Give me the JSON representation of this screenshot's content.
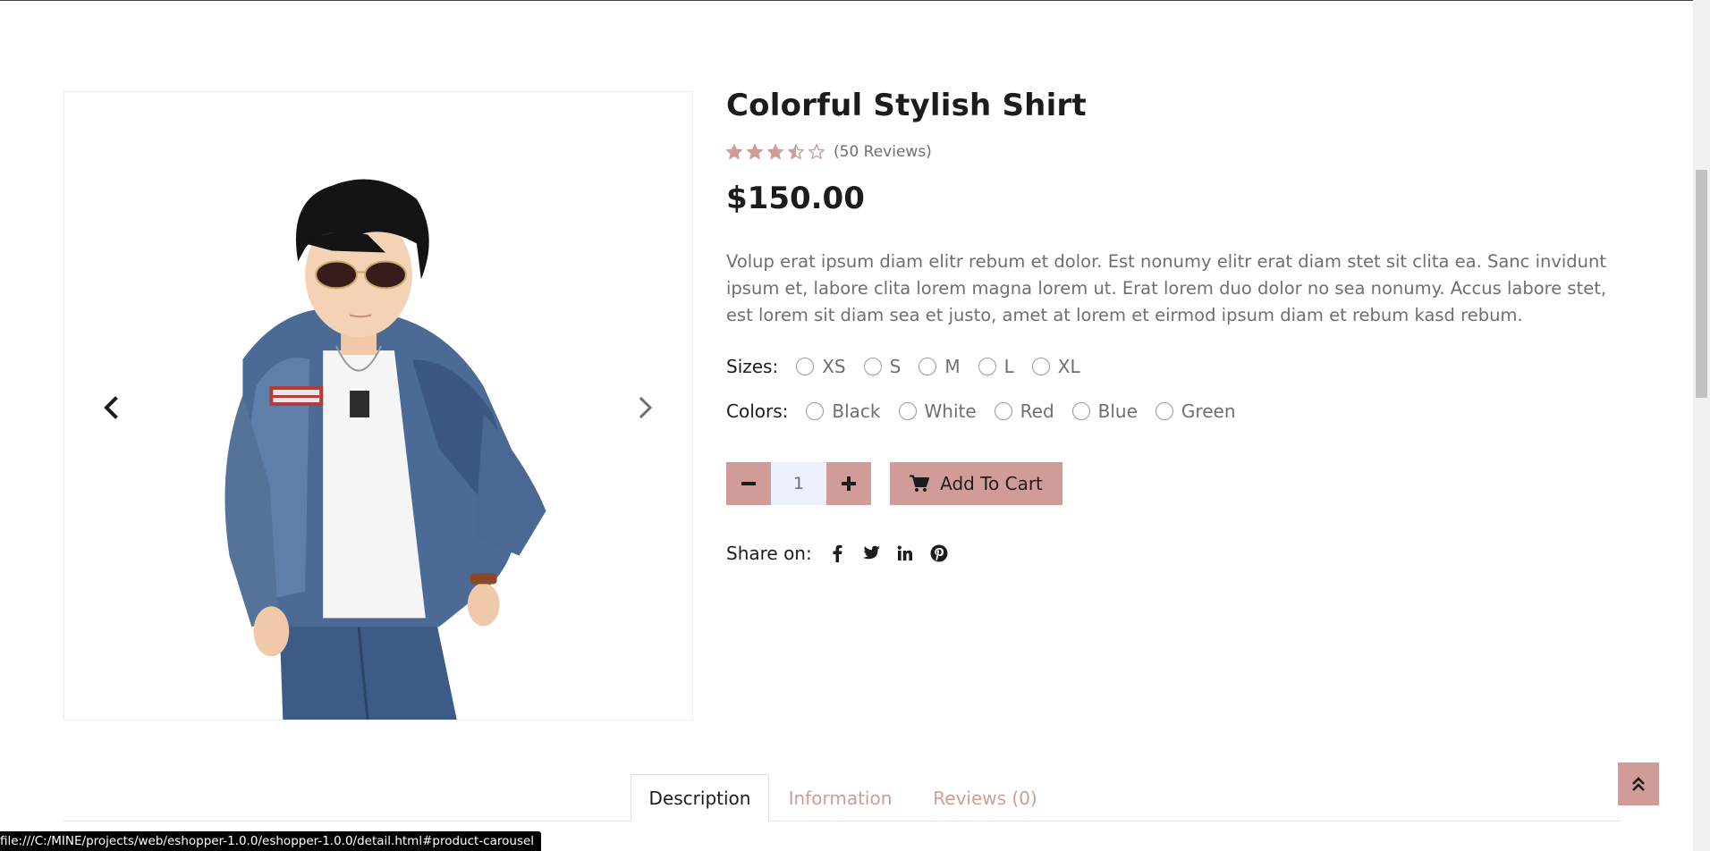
{
  "product": {
    "title": "Colorful Stylish Shirt",
    "rating": 3.5,
    "rating_max": 5,
    "reviews_text": "(50 Reviews)",
    "price": "$150.00",
    "description": "Volup erat ipsum diam elitr rebum et dolor. Est nonumy elitr erat diam stet sit clita ea. Sanc invidunt ipsum et, labore clita lorem magna lorem ut. Erat lorem duo dolor no sea nonumy. Accus labore stet, est lorem sit diam sea et justo, amet at lorem et eirmod ipsum diam et rebum kasd rebum."
  },
  "sizes": {
    "label": "Sizes:",
    "options": [
      "XS",
      "S",
      "M",
      "L",
      "XL"
    ]
  },
  "colors": {
    "label": "Colors:",
    "options": [
      "Black",
      "White",
      "Red",
      "Blue",
      "Green"
    ]
  },
  "cart": {
    "quantity": "1",
    "add_label": "Add To Cart"
  },
  "share": {
    "label": "Share on:",
    "networks": [
      "facebook-icon",
      "twitter-icon",
      "linkedin-icon",
      "pinterest-icon"
    ]
  },
  "tabs": [
    {
      "label": "Description",
      "active": true
    },
    {
      "label": "Information",
      "active": false
    },
    {
      "label": "Reviews (0)",
      "active": false
    }
  ],
  "status_bar": {
    "url": "file:///C:/MINE/projects/web/eshopper-1.0.0/eshopper-1.0.0/detail.html#product-carousel"
  },
  "colors_theme": {
    "primary": "#d19c97",
    "secondary": "#edf1ff",
    "text_dark": "#1c1c1c",
    "text_muted": "#6f6f6f"
  },
  "icons": {
    "carousel_prev": "chevron-left-icon",
    "carousel_next": "chevron-right-icon",
    "cart": "shopping-cart-icon",
    "back_to_top": "double-chevron-up-icon"
  }
}
